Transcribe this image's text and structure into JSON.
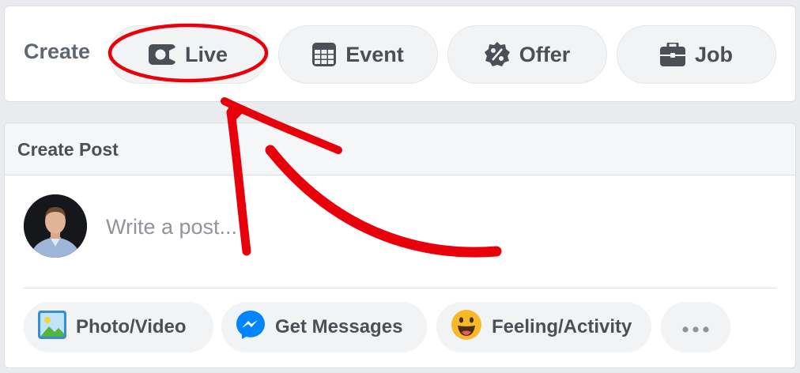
{
  "create": {
    "label": "Create",
    "buttons": [
      {
        "label": "Live",
        "icon": "video-camera-icon"
      },
      {
        "label": "Event",
        "icon": "calendar-icon"
      },
      {
        "label": "Offer",
        "icon": "percent-badge-icon"
      },
      {
        "label": "Job",
        "icon": "briefcase-icon"
      }
    ]
  },
  "post": {
    "title": "Create Post",
    "placeholder": "Write a post...",
    "actions": [
      {
        "label": "Photo/Video",
        "icon": "photo-icon"
      },
      {
        "label": "Get Messages",
        "icon": "messenger-icon"
      },
      {
        "label": "Feeling/Activity",
        "icon": "smiley-icon"
      },
      {
        "label": "",
        "icon": "more-dots-icon"
      }
    ]
  },
  "annotation": {
    "color": "#e8000b",
    "highlight": "Live"
  }
}
